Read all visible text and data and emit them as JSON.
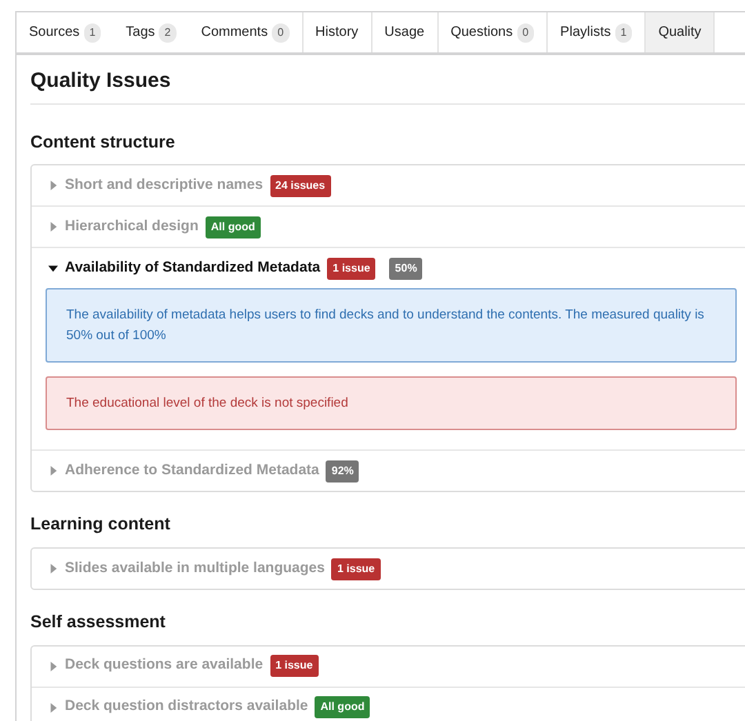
{
  "tabs": [
    {
      "label": "Sources",
      "count": "1",
      "selected": false
    },
    {
      "label": "Tags",
      "count": "2",
      "selected": false
    },
    {
      "label": "Comments",
      "count": "0",
      "selected": false
    },
    {
      "label": "History",
      "selected": false
    },
    {
      "label": "Usage",
      "selected": false
    },
    {
      "label": "Questions",
      "count": "0",
      "selected": false
    },
    {
      "label": "Playlists",
      "count": "1",
      "selected": false
    },
    {
      "label": "Quality",
      "selected": true
    }
  ],
  "title": "Quality Issues",
  "sections": [
    {
      "heading": "Content structure",
      "items": [
        {
          "label": "Short and descriptive names",
          "expanded": false,
          "badges": [
            {
              "kind": "issue",
              "text": "24 issues"
            }
          ]
        },
        {
          "label": "Hierarchical design",
          "expanded": false,
          "badges": [
            {
              "kind": "good",
              "text": "All good"
            }
          ]
        },
        {
          "label": "Availability of Standardized Metadata",
          "expanded": true,
          "badges": [
            {
              "kind": "issue",
              "text": "1 issue"
            },
            {
              "kind": "percent",
              "text": "50%"
            }
          ],
          "messages": [
            {
              "kind": "info",
              "text": "The availability of metadata helps users to find decks and to understand the contents. The measured quality is 50% out of 100%"
            },
            {
              "kind": "error",
              "text": "The educational level of the deck is not specified"
            }
          ]
        },
        {
          "label": "Adherence to Standardized Metadata",
          "expanded": false,
          "badges": [
            {
              "kind": "percent",
              "text": "92%"
            }
          ]
        }
      ]
    },
    {
      "heading": "Learning content",
      "items": [
        {
          "label": "Slides available in multiple languages",
          "expanded": false,
          "badges": [
            {
              "kind": "issue",
              "text": "1 issue"
            }
          ]
        }
      ]
    },
    {
      "heading": "Self assessment",
      "items": [
        {
          "label": "Deck questions are available",
          "expanded": false,
          "badges": [
            {
              "kind": "issue",
              "text": "1 issue"
            }
          ]
        },
        {
          "label": "Deck question distractors available",
          "expanded": false,
          "badges": [
            {
              "kind": "good",
              "text": "All good"
            }
          ]
        }
      ]
    }
  ]
}
